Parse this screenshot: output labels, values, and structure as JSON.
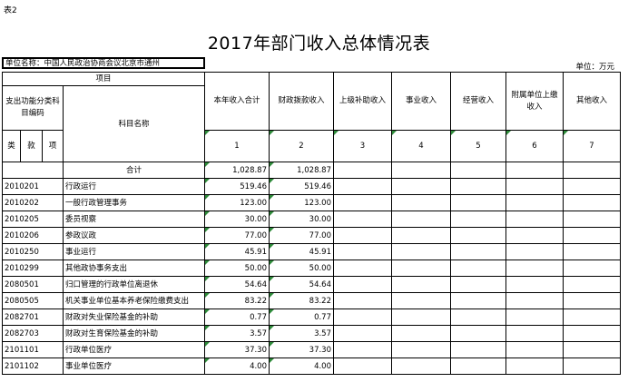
{
  "sheet_label": "表2",
  "title": "2017年部门收入总体情况表",
  "unit_name": "单位名称：中国人民政治协商会议北京市通州",
  "unit": "单位：万元",
  "header": {
    "project": "项目",
    "func_code": "支出功能分类科目编码",
    "subject_name": "科目名称",
    "lei": "类",
    "kuan": "款",
    "xiang": "项",
    "columns": [
      "本年收入合计",
      "财政拨款收入",
      "上级补助收入",
      "事业收入",
      "经营收入",
      "附属单位上缴收入",
      "其他收入"
    ],
    "column_label": "栏次",
    "column_numbers": [
      "1",
      "2",
      "3",
      "4",
      "5",
      "6",
      "7"
    ],
    "total_label": "合计",
    "total_values": [
      "1,028.87",
      "1,028.87",
      "",
      "",
      "",
      "",
      ""
    ]
  },
  "rows": [
    {
      "code": "2010201",
      "name": "行政运行",
      "total": "519.46",
      "fiscal": "519.46"
    },
    {
      "code": "2010202",
      "name": "一般行政管理事务",
      "total": "123.00",
      "fiscal": "123.00"
    },
    {
      "code": "2010205",
      "name": "委员视察",
      "total": "30.00",
      "fiscal": "30.00"
    },
    {
      "code": "2010206",
      "name": "参政议政",
      "total": "77.00",
      "fiscal": "77.00"
    },
    {
      "code": "2010250",
      "name": "事业运行",
      "total": "45.91",
      "fiscal": "45.91"
    },
    {
      "code": "2010299",
      "name": "其他政协事务支出",
      "total": "50.00",
      "fiscal": "50.00"
    },
    {
      "code": "2080501",
      "name": "归口管理的行政单位离退休",
      "total": "54.64",
      "fiscal": "54.64"
    },
    {
      "code": "2080505",
      "name": "机关事业单位基本养老保险缴费支出",
      "total": "83.22",
      "fiscal": "83.22"
    },
    {
      "code": "2082701",
      "name": "财政对失业保险基金的补助",
      "total": "0.77",
      "fiscal": "0.77"
    },
    {
      "code": "2082703",
      "name": "财政对生育保险基金的补助",
      "total": "3.57",
      "fiscal": "3.57"
    },
    {
      "code": "2101101",
      "name": "行政单位医疗",
      "total": "37.30",
      "fiscal": "37.30"
    },
    {
      "code": "2101102",
      "name": "事业单位医疗",
      "total": "4.00",
      "fiscal": "4.00"
    }
  ]
}
